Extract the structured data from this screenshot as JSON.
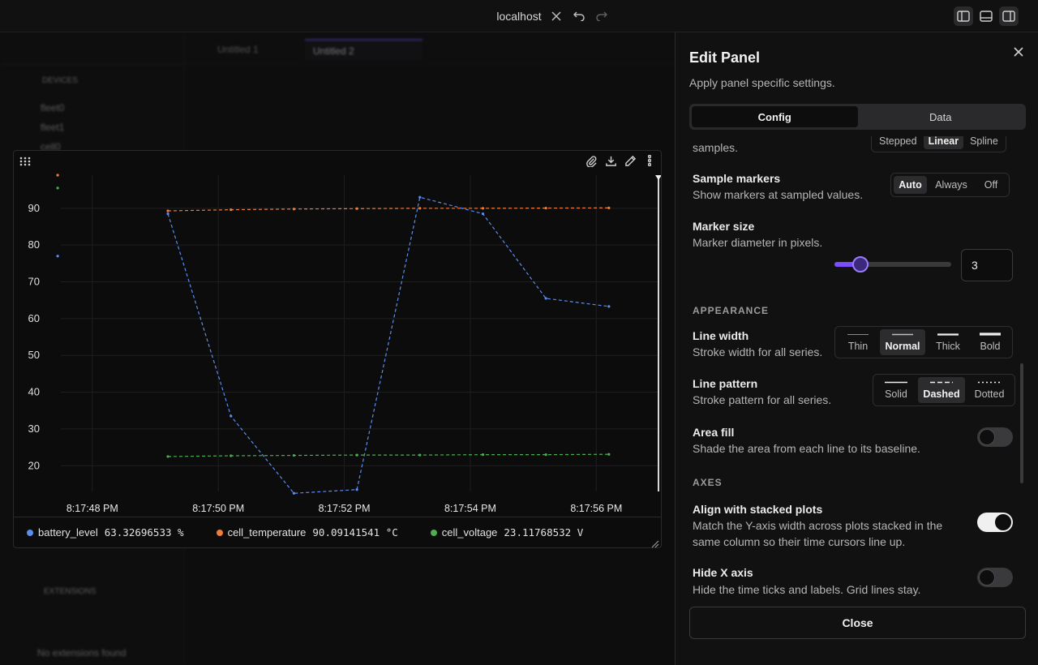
{
  "window": {
    "title": "localhost"
  },
  "edit_panel": {
    "title": "Edit Panel",
    "subtitle": "Apply panel specific settings.",
    "tabs": [
      {
        "label": "Config",
        "active": true
      },
      {
        "label": "Data",
        "active": false
      }
    ],
    "interpolation": {
      "desc_tail": "samples.",
      "options": [
        {
          "label": "Stepped",
          "active": false
        },
        {
          "label": "Linear",
          "active": true
        },
        {
          "label": "Spline",
          "active": false
        }
      ]
    },
    "sample_markers": {
      "label": "Sample markers",
      "desc": "Show markers at sampled values.",
      "options": [
        {
          "label": "Auto",
          "active": true
        },
        {
          "label": "Always",
          "active": false
        },
        {
          "label": "Off",
          "active": false
        }
      ]
    },
    "marker_size": {
      "label": "Marker size",
      "desc": "Marker diameter in pixels.",
      "value": "3",
      "slider_fraction": 0.22
    },
    "appearance_header": "APPEARANCE",
    "line_width": {
      "label": "Line width",
      "desc": "Stroke width for all series.",
      "options": [
        {
          "label": "Thin",
          "active": false
        },
        {
          "label": "Normal",
          "active": true
        },
        {
          "label": "Thick",
          "active": false
        },
        {
          "label": "Bold",
          "active": false
        }
      ]
    },
    "line_pattern": {
      "label": "Line pattern",
      "desc": "Stroke pattern for all series.",
      "options": [
        {
          "label": "Solid",
          "active": false
        },
        {
          "label": "Dashed",
          "active": true
        },
        {
          "label": "Dotted",
          "active": false
        }
      ]
    },
    "area_fill": {
      "label": "Area fill",
      "desc": "Shade the area from each line to its baseline.",
      "enabled": false
    },
    "axes_header": "AXES",
    "align_stacked": {
      "label": "Align with stacked plots",
      "desc_line1": "Match the Y-axis width across plots stacked in the",
      "desc_line2": "same column so their time cursors line up.",
      "enabled": true
    },
    "hide_x_axis": {
      "label": "Hide X axis",
      "desc": "Hide the time ticks and labels. Grid lines stay.",
      "enabled": false
    },
    "close_label": "Close"
  },
  "legend": [
    {
      "name": "battery_level",
      "value": "63.32696533 %",
      "color": "#5b8def"
    },
    {
      "name": "cell_temperature",
      "value": "90.09141541 °C",
      "color": "#f07d3a"
    },
    {
      "name": "cell_voltage",
      "value": "23.11768532 V",
      "color": "#4caf50"
    }
  ],
  "chart_data": {
    "type": "line",
    "x": [
      "8:17:49.2",
      "8:17:50.2",
      "8:17:51.2",
      "8:17:52.2",
      "8:17:53.2",
      "8:17:54.2",
      "8:17:55.2",
      "8:17:56.2"
    ],
    "x_seconds": [
      49.2,
      50.2,
      51.2,
      52.2,
      53.2,
      54.2,
      55.2,
      56.2
    ],
    "x_tick_labels": [
      "8:17:48 PM",
      "8:17:50 PM",
      "8:17:52 PM",
      "8:17:54 PM",
      "8:17:56 PM"
    ],
    "x_tick_seconds": [
      48,
      50,
      52,
      54,
      56
    ],
    "xlim_seconds": [
      47.5,
      57.0
    ],
    "y_ticks": [
      20,
      30,
      40,
      50,
      60,
      70,
      80,
      90
    ],
    "ylim": [
      13,
      99
    ],
    "line_pattern": "dashed",
    "series": [
      {
        "name": "battery_level",
        "color": "#5b8def",
        "values": [
          88.5,
          33.5,
          12.5,
          13.5,
          93.0,
          88.5,
          65.5,
          63.3
        ]
      },
      {
        "name": "cell_temperature",
        "color": "#f07d3a",
        "values": [
          89.3,
          89.6,
          89.8,
          89.9,
          90.0,
          90.0,
          90.05,
          90.1
        ]
      },
      {
        "name": "cell_voltage",
        "color": "#4caf50",
        "values": [
          22.5,
          22.7,
          22.8,
          22.9,
          22.9,
          23.0,
          23.0,
          23.1
        ]
      }
    ],
    "left_edge_points": [
      {
        "series": "cell_temperature",
        "x_seconds": 47.45,
        "y": 99.0
      },
      {
        "series": "cell_voltage",
        "x_seconds": 47.45,
        "y": 95.5
      },
      {
        "series": "battery_level",
        "x_seconds": 47.45,
        "y": 77.0
      }
    ],
    "grid": true
  },
  "background_app": {
    "tabs": [
      "Untitled 1",
      "Untitled 2"
    ],
    "tree_items": [
      "DEVICES",
      "fleet0",
      "fleet1",
      "cell0"
    ],
    "footer_labels": [
      "No extensions found",
      "EXTENSIONS"
    ]
  }
}
